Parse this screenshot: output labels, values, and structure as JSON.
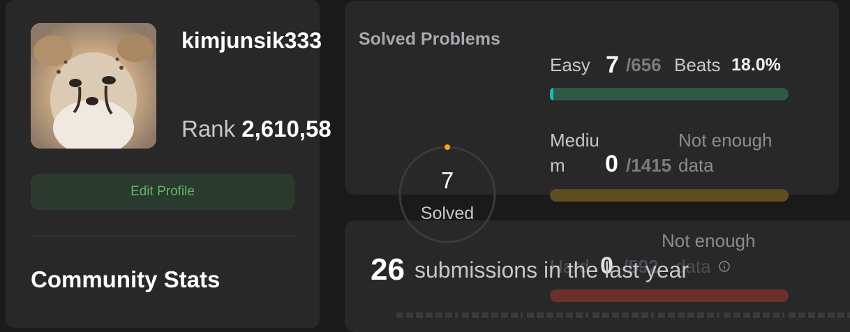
{
  "profile": {
    "username": "kimjunsik333",
    "rank_label": "Rank",
    "rank_value": "2,610,58",
    "edit_profile_label": "Edit Profile",
    "avatar_alt": "cheetah cub avatar"
  },
  "community": {
    "title": "Community Stats"
  },
  "solved": {
    "title": "Solved Problems",
    "ring_count": "7",
    "ring_label": "Solved",
    "easy": {
      "label": "Easy",
      "solved": "7",
      "total": "/656",
      "beats_label": "Beats",
      "beats_value": "18.0%",
      "progress": 0.0107,
      "color": "#1cbaba"
    },
    "medium": {
      "label_line1": "Mediu",
      "label_line2": "m",
      "solved": "0",
      "total": "/1415",
      "note_line1": "Not enough",
      "note_line2": "data",
      "progress": 0,
      "color": "#ffb700"
    },
    "hard": {
      "label": "Hard",
      "solved": "0",
      "total": "/592",
      "note_line1": "Not enough",
      "note_line2": "data",
      "progress": 0,
      "color": "#f63737"
    }
  },
  "submissions": {
    "count": "26",
    "text": "submissions in the last year"
  }
}
